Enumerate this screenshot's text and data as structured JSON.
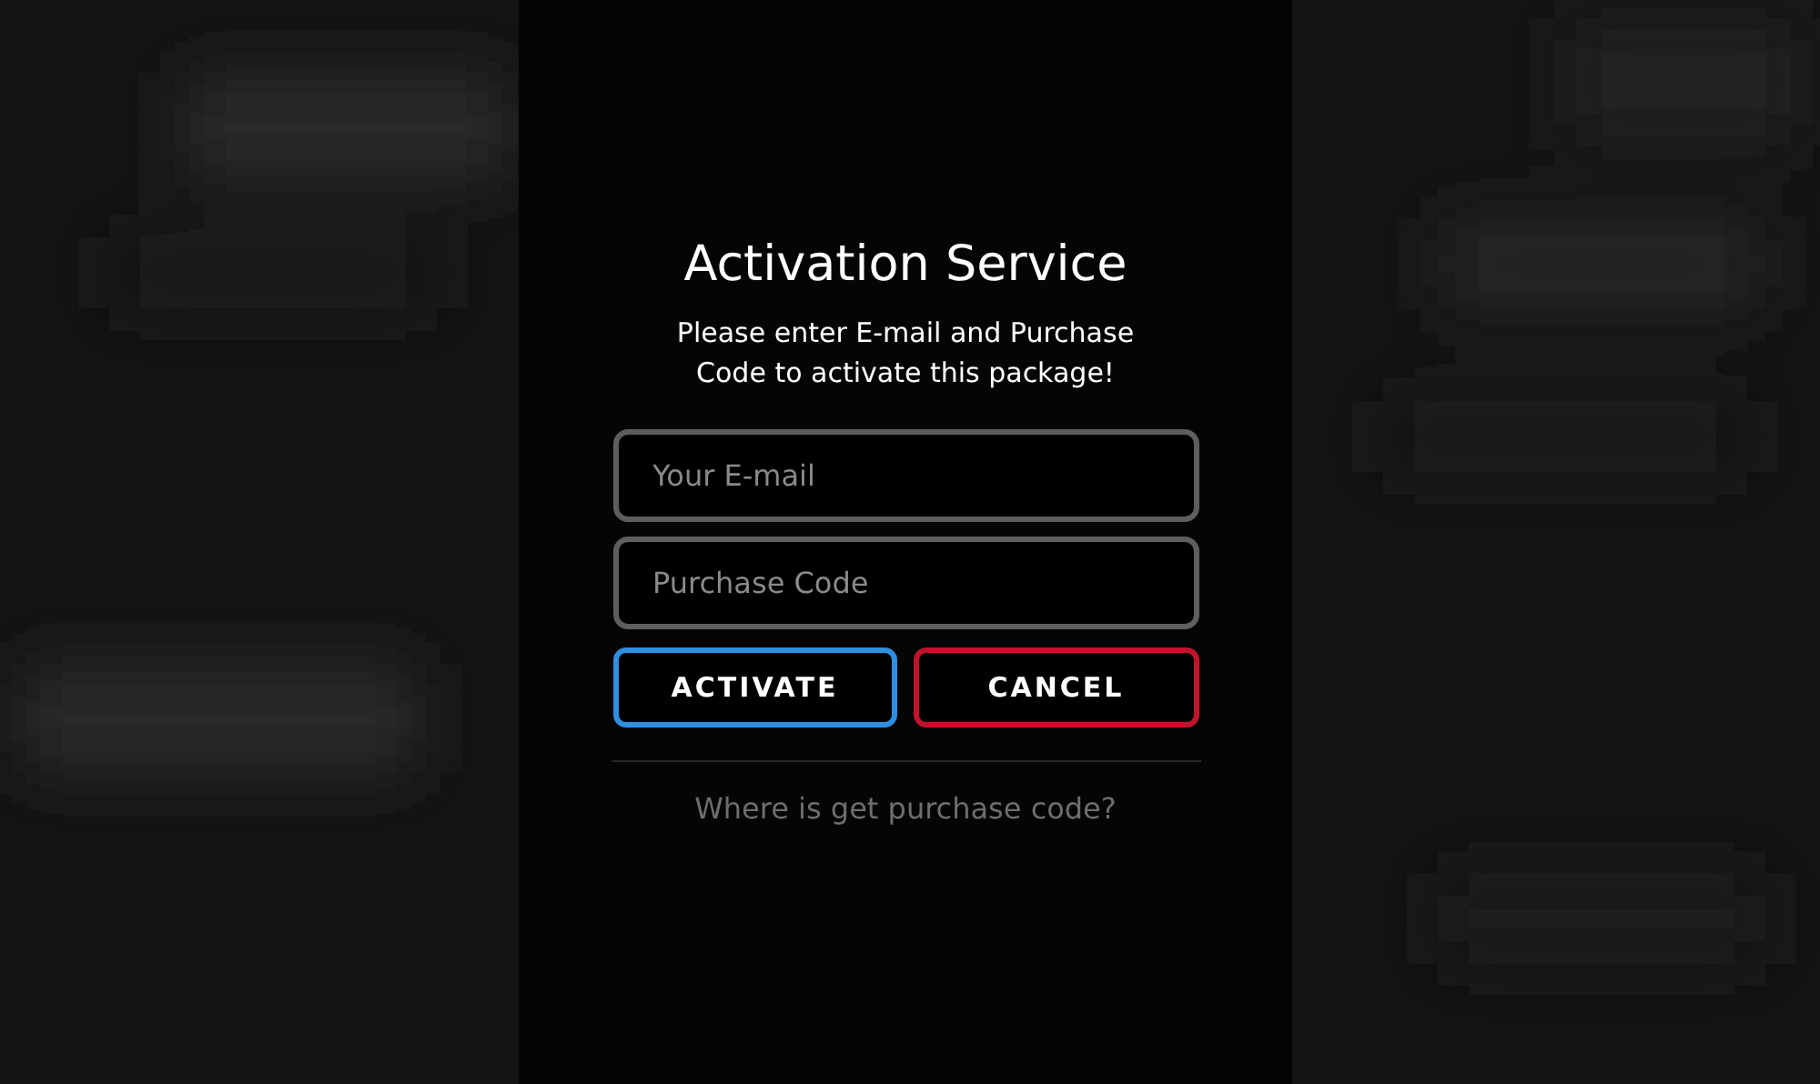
{
  "dialog": {
    "title": "Activation Service",
    "message": "Please enter E-mail and Purchase Code to activate this package!",
    "fields": [
      {
        "placeholder": "Your E-mail"
      },
      {
        "placeholder": "Purchase Code"
      }
    ],
    "buttons": [
      {
        "label": "ACTIVATE",
        "kind": "confirm"
      },
      {
        "label": "CANCEL",
        "kind": "cancel"
      }
    ],
    "help_link": "Where is get purchase code?"
  }
}
